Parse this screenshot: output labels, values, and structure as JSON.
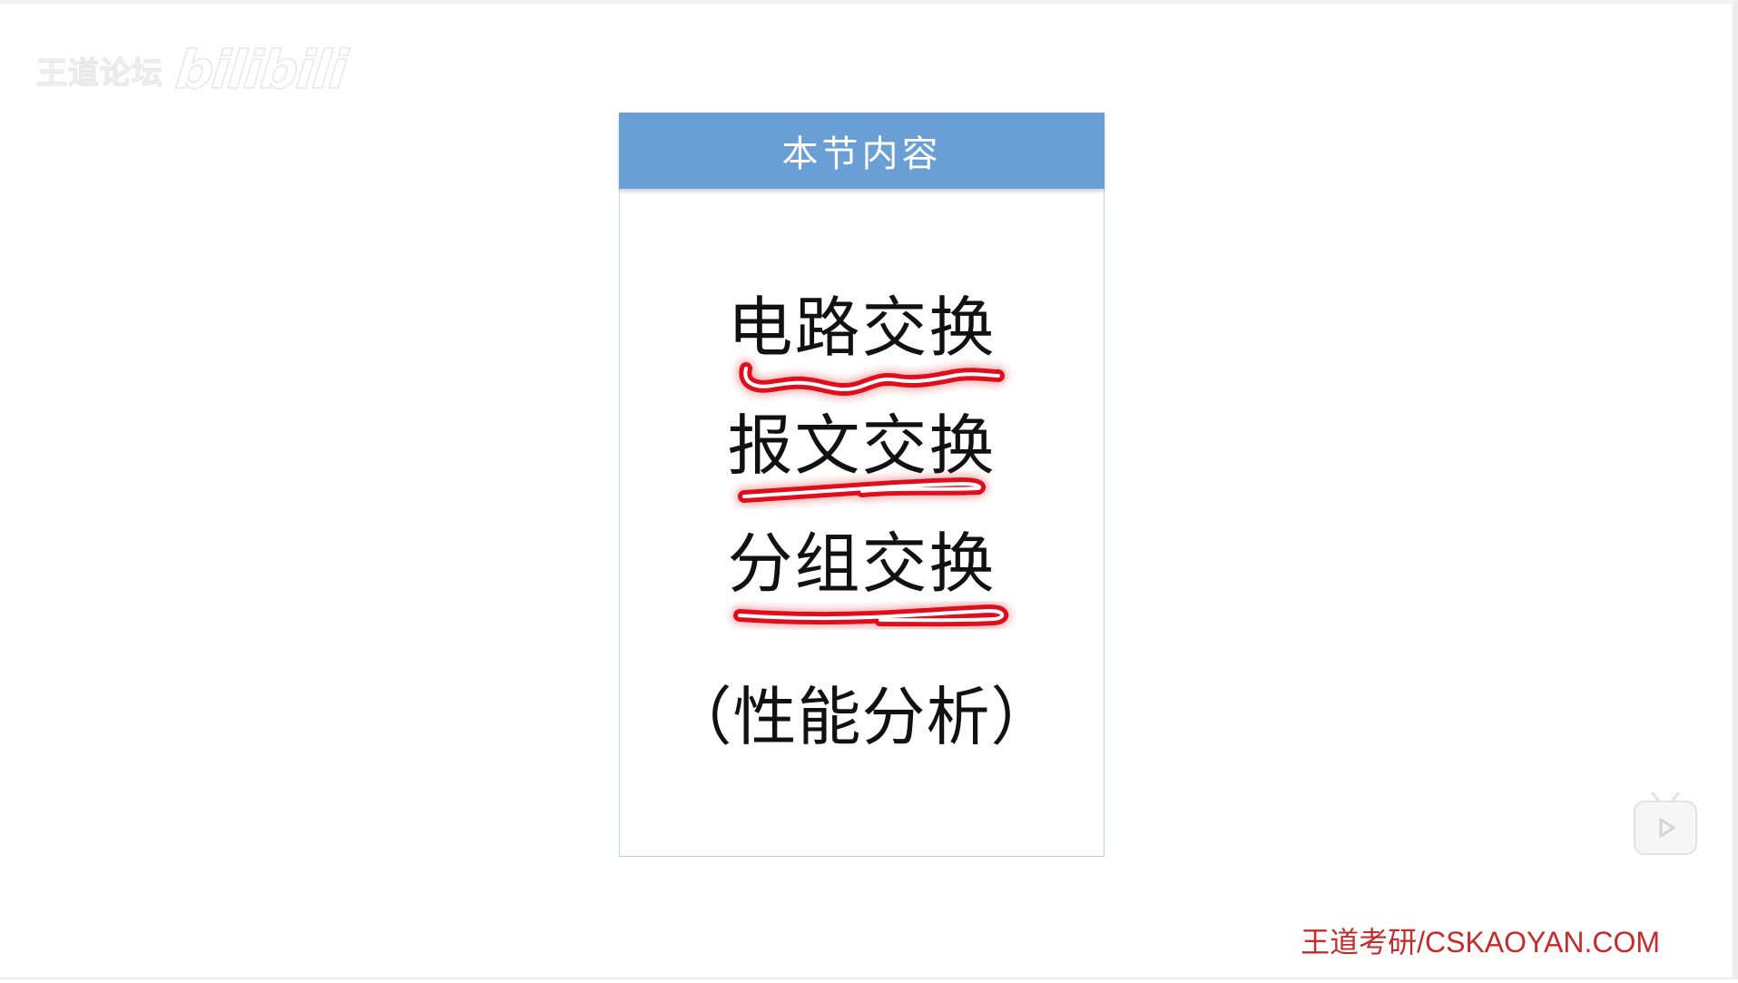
{
  "watermark": {
    "brand_text": "王道论坛",
    "logo_text": "bilibili"
  },
  "card": {
    "title": "本节内容",
    "topics": [
      "电路交换",
      "报文交换",
      "分组交换"
    ],
    "note": "（性能分析）"
  },
  "footer": {
    "brand": "王道考研/CSKAOYAN.COM"
  },
  "colors": {
    "header_bg": "#6a9fd6",
    "underline": "#e0101a",
    "brand": "#c62b2b"
  },
  "icons": {
    "play": "play-icon"
  }
}
